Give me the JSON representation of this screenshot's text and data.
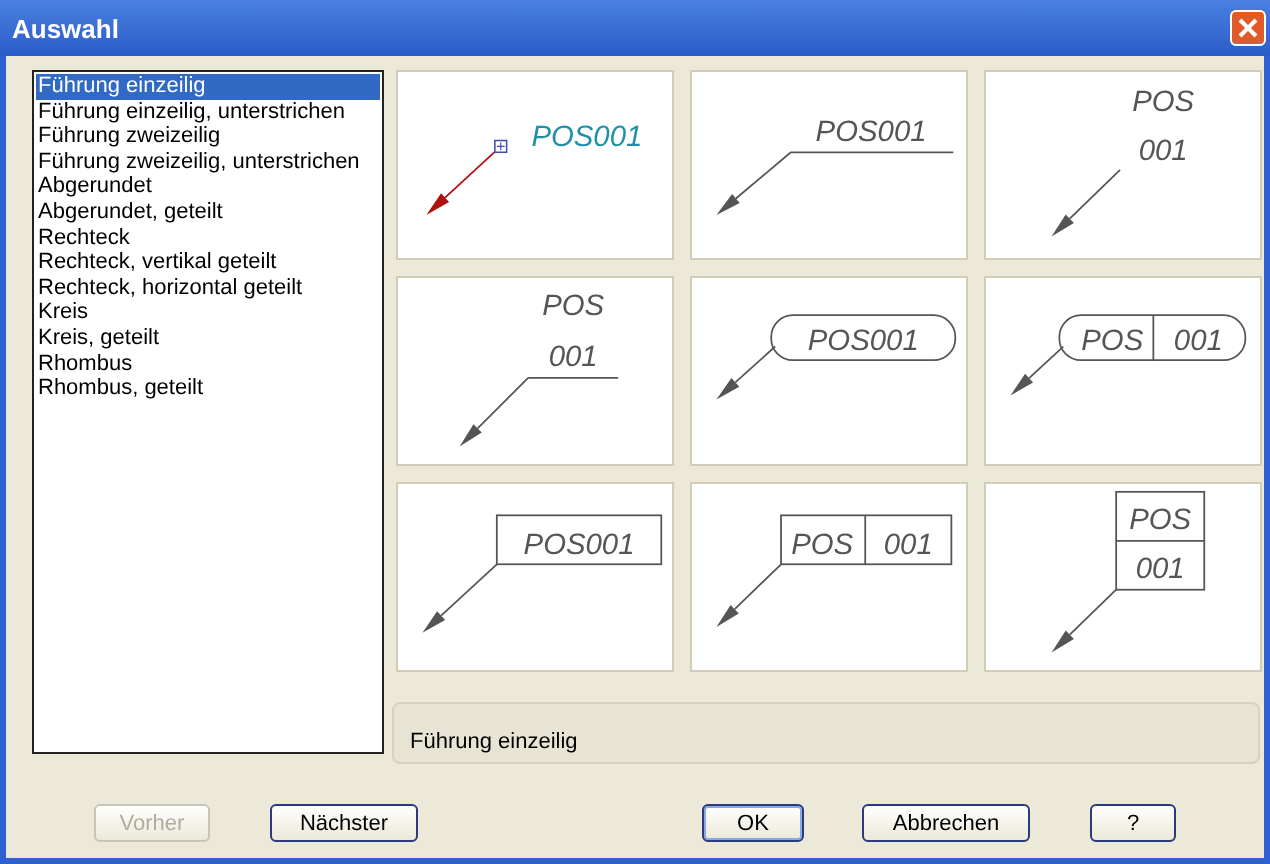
{
  "window": {
    "title": "Auswahl"
  },
  "styles": [
    {
      "label": "Führung einzeilig",
      "selected": true
    },
    {
      "label": "Führung einzeilig, unterstrichen",
      "selected": false
    },
    {
      "label": "Führung zweizeilig",
      "selected": false
    },
    {
      "label": "Führung zweizeilig, unterstrichen",
      "selected": false
    },
    {
      "label": "Abgerundet",
      "selected": false
    },
    {
      "label": "Abgerundet, geteilt",
      "selected": false
    },
    {
      "label": "Rechteck",
      "selected": false
    },
    {
      "label": "Rechteck, vertikal geteilt",
      "selected": false
    },
    {
      "label": "Rechteck, horizontal geteilt",
      "selected": false
    },
    {
      "label": "Kreis",
      "selected": false
    },
    {
      "label": "Kreis, geteilt",
      "selected": false
    },
    {
      "label": "Rhombus",
      "selected": false
    },
    {
      "label": "Rhombus, geteilt",
      "selected": false
    }
  ],
  "previews": [
    {
      "kind": "plain",
      "texts": [
        "POS001"
      ],
      "selected": true
    },
    {
      "kind": "underlined",
      "texts": [
        "POS001"
      ],
      "selected": false
    },
    {
      "kind": "two-line",
      "texts": [
        "POS",
        "001"
      ],
      "selected": false
    },
    {
      "kind": "two-line-underlined",
      "texts": [
        "POS",
        "001"
      ],
      "selected": false
    },
    {
      "kind": "rounded",
      "texts": [
        "POS001"
      ],
      "selected": false
    },
    {
      "kind": "rounded-split",
      "texts": [
        "POS",
        "001"
      ],
      "selected": false
    },
    {
      "kind": "rectangle",
      "texts": [
        "POS001"
      ],
      "selected": false
    },
    {
      "kind": "rectangle-vsplit",
      "texts": [
        "POS",
        "001"
      ],
      "selected": false
    },
    {
      "kind": "rectangle-hsplit",
      "texts": [
        "POS",
        "001"
      ],
      "selected": false
    }
  ],
  "description": "Führung einzeilig",
  "buttons": [
    {
      "label": "Vorher",
      "disabled": true,
      "default": false
    },
    {
      "label": "Nächster",
      "disabled": false,
      "default": false
    },
    {
      "label": "OK",
      "disabled": false,
      "default": true
    },
    {
      "label": "Abbrechen",
      "disabled": false,
      "default": false
    },
    {
      "label": "?",
      "disabled": false,
      "default": false
    }
  ]
}
